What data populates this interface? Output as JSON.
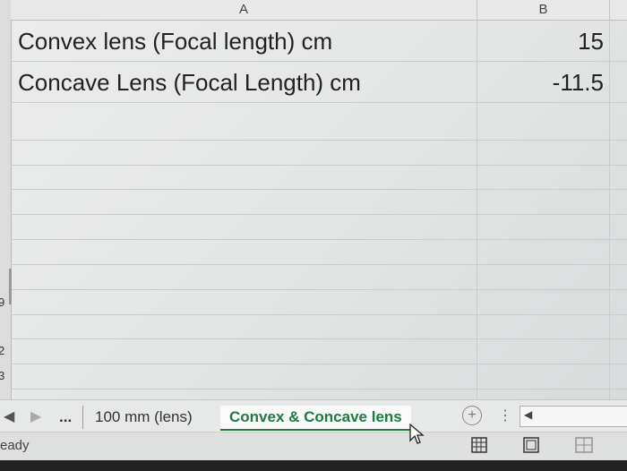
{
  "columns": {
    "a": "A",
    "b": "B"
  },
  "rows": [
    {
      "label": "Convex lens (Focal length) cm",
      "value": "15"
    },
    {
      "label": "Concave Lens (Focal Length) cm",
      "value": "-11.5"
    }
  ],
  "row_numbers_partial": [
    "9",
    "2",
    "3"
  ],
  "tabs": {
    "ellipsis": "...",
    "items": [
      {
        "label": "100 mm (lens)",
        "active": false
      },
      {
        "label": "Convex & Concave lens",
        "active": true
      }
    ]
  },
  "status": {
    "ready": "eady"
  },
  "colors": {
    "active_tab": "#1e7a3e",
    "grid": "#c9cccc"
  }
}
